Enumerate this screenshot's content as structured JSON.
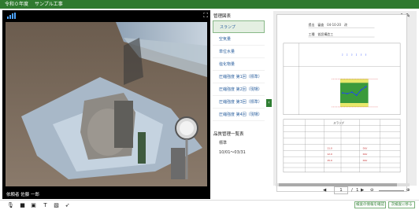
{
  "header": {
    "title": "令和０年度",
    "project": "サンプル工事"
  },
  "video": {
    "caption": "佐藤 一郎"
  },
  "sidebar": {
    "section1_title": "管理図表",
    "items": [
      {
        "label": "スランプ"
      },
      {
        "label": "空気量"
      },
      {
        "label": "単位水量"
      },
      {
        "label": "塩化物量"
      },
      {
        "label": "圧縮強度 第1回（標準）"
      },
      {
        "label": "圧縮強度 第2回（現場）"
      },
      {
        "label": "圧縮強度 第3回（標準）"
      },
      {
        "label": "圧縮強度 第4回（現場）"
      }
    ],
    "section2_title": "品質管理一覧表",
    "sub_label": "標準",
    "date_range": "10/01〜03/31"
  },
  "document": {
    "page_current": "1",
    "page_total": "1",
    "date_label": "提出　審査　04-10-20　改",
    "work_label": "工種　仮設構造工",
    "table_title": "スランプ",
    "row_labels": [
      "X",
      "R",
      "X",
      "R",
      "X",
      "R"
    ],
    "chart_label": "折\n計\n値"
  },
  "buttons": {
    "complete": "検査の情報を確認",
    "next": "次検査に移る"
  }
}
